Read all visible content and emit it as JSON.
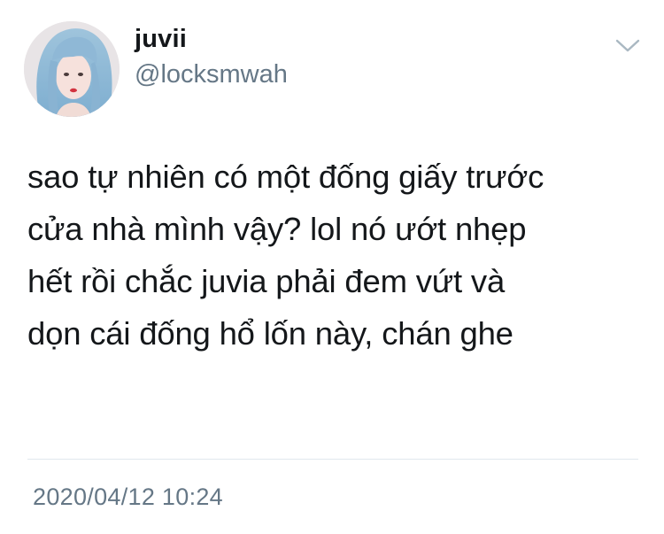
{
  "tweet": {
    "author": {
      "display_name": "juvii",
      "handle": "@locksmwah",
      "avatar_icon": "avatar-photo-blue-hair-girl"
    },
    "menu_icon": "chevron-down-icon",
    "text": "sao tự nhiên có một đống giấy trước\ncửa nhà mình vậy? lol nó ướt nhẹp\nhết rồi chắc juvia phải đem vứt và\ndọn cái đống hổ lốn này, chán ghe",
    "timestamp": "2020/04/12 10:24"
  },
  "colors": {
    "primary_text": "#14171a",
    "secondary_text": "#657786",
    "divider": "#e1e8ed",
    "chevron": "#aab8c2"
  }
}
